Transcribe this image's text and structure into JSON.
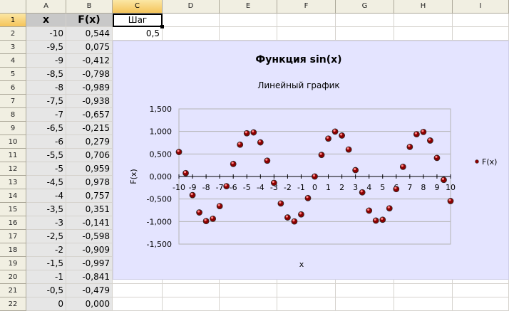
{
  "columns": [
    "A",
    "B",
    "C",
    "D",
    "E",
    "F",
    "G",
    "H",
    "I"
  ],
  "selected_column": "C",
  "rows": [
    "1",
    "2",
    "3",
    "4",
    "5",
    "6",
    "7",
    "8",
    "9",
    "10",
    "11",
    "12",
    "13",
    "14",
    "15",
    "16",
    "17",
    "18",
    "19",
    "20",
    "21",
    "22"
  ],
  "selected_row": "1",
  "header_x": "x",
  "header_fx": "F(x)",
  "step_label": "Шаг",
  "step_value": "0,5",
  "x_values": [
    "-10",
    "-9,5",
    "-9",
    "-8,5",
    "-8",
    "-7,5",
    "-7",
    "-6,5",
    "-6",
    "-5,5",
    "-5",
    "-4,5",
    "-4",
    "-3,5",
    "-3",
    "-2,5",
    "-2",
    "-1,5",
    "-1",
    "-0,5",
    "0"
  ],
  "fx_values": [
    "0,544",
    "0,075",
    "-0,412",
    "-0,798",
    "-0,989",
    "-0,938",
    "-0,657",
    "-0,215",
    "0,279",
    "0,706",
    "0,959",
    "0,978",
    "0,757",
    "0,351",
    "-0,141",
    "-0,598",
    "-0,909",
    "-0,997",
    "-0,841",
    "-0,479",
    "0,000"
  ],
  "chart_data": {
    "type": "scatter",
    "title": "Функция sin(x)",
    "subtitle": "Линейный график",
    "xlabel": "x",
    "ylabel": "F(x)",
    "legend": "F(x)",
    "legend_position": "right",
    "xlim": [
      -10,
      10
    ],
    "ylim": [
      -1.5,
      1.5
    ],
    "y_ticks": [
      "1,500",
      "1,000",
      "0,500",
      "0,000",
      "-0,500",
      "-1,000",
      "-1,500"
    ],
    "x_ticks": [
      "-10",
      "-9",
      "-8",
      "-7",
      "-6",
      "-5",
      "-4",
      "-3",
      "-2",
      "-1",
      "0",
      "1",
      "2",
      "3",
      "4",
      "5",
      "6",
      "7",
      "8",
      "9",
      "10"
    ],
    "grid": true,
    "marker_color": "#8b0000",
    "series": [
      {
        "name": "F(x)",
        "x": [
          -10,
          -9.5,
          -9,
          -8.5,
          -8,
          -7.5,
          -7,
          -6.5,
          -6,
          -5.5,
          -5,
          -4.5,
          -4,
          -3.5,
          -3,
          -2.5,
          -2,
          -1.5,
          -1,
          -0.5,
          0,
          0.5,
          1,
          1.5,
          2,
          2.5,
          3,
          3.5,
          4,
          4.5,
          5,
          5.5,
          6,
          6.5,
          7,
          7.5,
          8,
          8.5,
          9,
          9.5,
          10
        ],
        "y": [
          0.544,
          0.075,
          -0.412,
          -0.798,
          -0.989,
          -0.938,
          -0.657,
          -0.215,
          0.279,
          0.706,
          0.959,
          0.978,
          0.757,
          0.351,
          -0.141,
          -0.598,
          -0.909,
          -0.997,
          -0.841,
          -0.479,
          0,
          0.479,
          0.841,
          0.997,
          0.909,
          0.598,
          0.141,
          -0.351,
          -0.757,
          -0.978,
          -0.959,
          -0.706,
          -0.279,
          0.215,
          0.657,
          0.938,
          0.989,
          0.798,
          0.412,
          -0.075,
          -0.544
        ]
      }
    ]
  }
}
